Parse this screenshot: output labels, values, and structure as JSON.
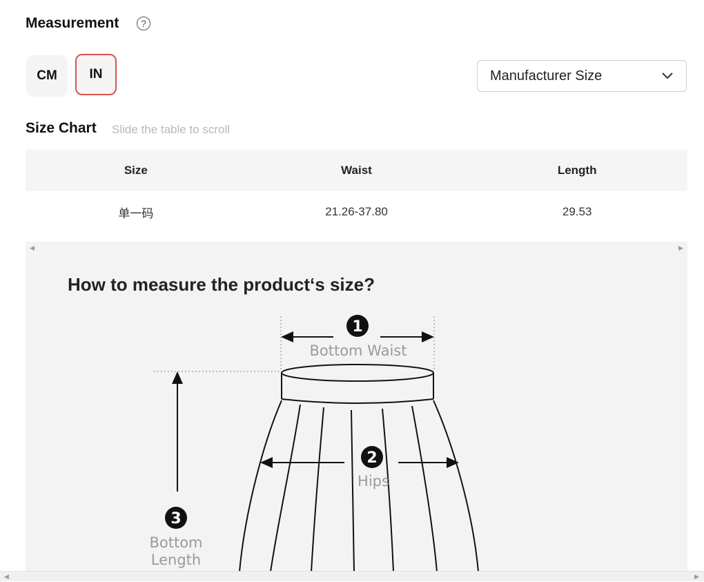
{
  "measurement": {
    "title": "Measurement",
    "help_glyph": "?"
  },
  "units": {
    "cm_label": "CM",
    "in_label": "IN",
    "active": "IN"
  },
  "size_select": {
    "value": "Manufacturer Size"
  },
  "size_chart": {
    "title": "Size Chart",
    "hint": "Slide the table to scroll",
    "columns": [
      "Size",
      "Waist",
      "Length"
    ],
    "rows": [
      [
        "单一码",
        "21.26-37.80",
        "29.53"
      ]
    ]
  },
  "guide": {
    "title": "How to measure the product‘s size?",
    "labels": {
      "waist_num": "1",
      "waist": "Bottom Waist",
      "hips_num": "2",
      "hips": "Hips",
      "length_num": "3",
      "length_line1": "Bottom",
      "length_line2": "Length"
    }
  },
  "colors": {
    "accent_border": "#d9534f",
    "header_bg": "#f5f5f5",
    "panel_bg": "#f3f3f3"
  }
}
